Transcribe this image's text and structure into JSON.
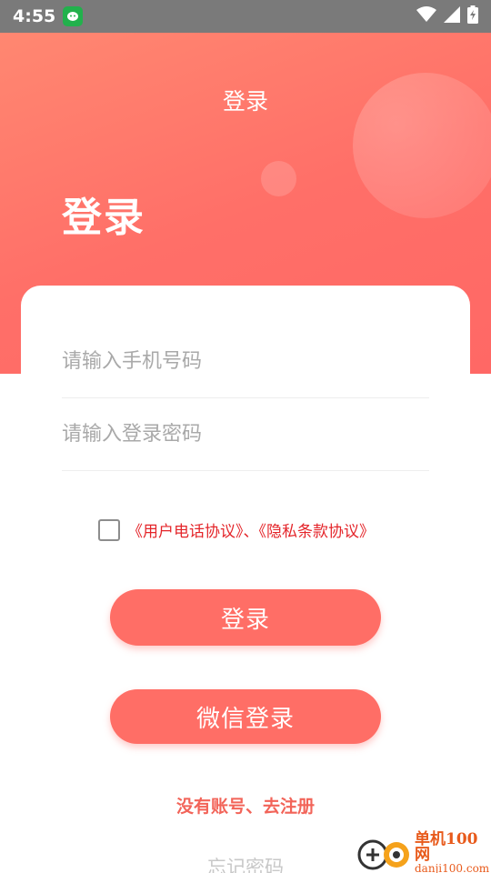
{
  "status_bar": {
    "time": "4:55"
  },
  "header": {
    "nav_title": "登录",
    "page_title": "登录"
  },
  "form": {
    "phone_placeholder": "请输入手机号码",
    "password_placeholder": "请输入登录密码"
  },
  "agreement": {
    "text": "《用户电话协议》、《隐私条款协议》",
    "checked": false
  },
  "buttons": {
    "login": "登录",
    "wechat_login": "微信登录"
  },
  "links": {
    "register": "没有账号、去注册",
    "forgot_password": "忘记密码"
  },
  "watermark": {
    "name": "单机100网",
    "url": "danji100.com"
  },
  "colors": {
    "accent": "#ff6e66",
    "agreement_text": "#e4252a",
    "status_bar": "#7a7a7a"
  }
}
